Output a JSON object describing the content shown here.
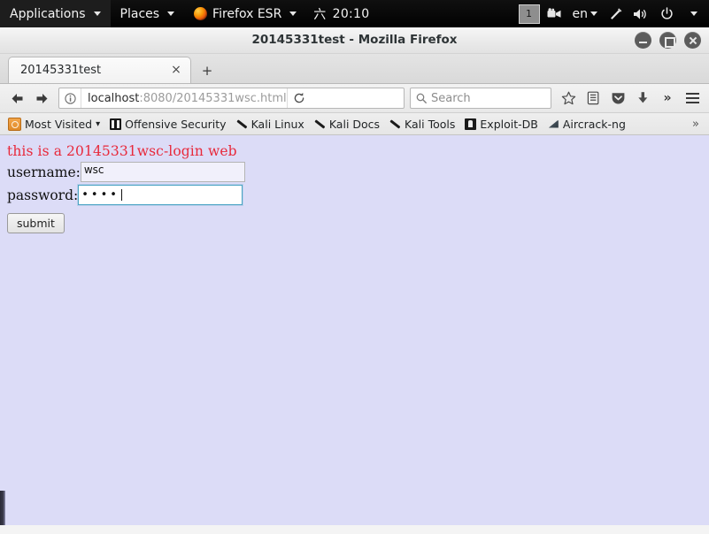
{
  "desktop_panel": {
    "menus": [
      {
        "label": "Applications",
        "icon": "chevron-down-icon"
      },
      {
        "label": "Places",
        "icon": "chevron-down-icon"
      },
      {
        "label": "Firefox ESR",
        "icon": "firefox-icon"
      }
    ],
    "clock": {
      "day": "六",
      "time": "20:10"
    },
    "workspace": "1",
    "tray": {
      "screencast_icon": "video-camera-icon",
      "language": "en",
      "language_caret": "chevron-down-icon",
      "network_icon": "signal-icon",
      "volume_icon": "speaker-icon",
      "power_icon": "power-icon",
      "power_caret": "chevron-down-icon"
    }
  },
  "window": {
    "title": "20145331test - Mozilla Firefox",
    "controls": {
      "minimize": "minimize-button",
      "maximize": "maximize-button",
      "close": "close-button"
    }
  },
  "tabs": {
    "items": [
      {
        "label": "20145331test",
        "close": "×"
      }
    ],
    "new_tab": "+"
  },
  "navbar": {
    "back": "←",
    "forward": "→",
    "identity_icon": "info-icon",
    "url_host": "localhost",
    "url_path": ":8080/20145331wsc.html",
    "reload": "⟳",
    "search_placeholder": "Search",
    "search_icon": "search-icon",
    "bookmark_icon": "star-icon",
    "library_icon": "library-icon",
    "pocket_icon": "pocket-icon",
    "downloads_icon": "download-icon",
    "overflow": "»",
    "menu_icon": "hamburger-menu-icon"
  },
  "bookmarks": {
    "items": [
      {
        "label": "Most Visited",
        "icon": "most-visited-icon",
        "caret": "▾"
      },
      {
        "label": "Offensive Security",
        "icon": "offensive-security-icon"
      },
      {
        "label": "Kali Linux",
        "icon": "kali-dragon-icon"
      },
      {
        "label": "Kali Docs",
        "icon": "kali-dragon-icon"
      },
      {
        "label": "Kali Tools",
        "icon": "kali-dragon-icon"
      },
      {
        "label": "Exploit-DB",
        "icon": "exploit-db-icon"
      },
      {
        "label": "Aircrack-ng",
        "icon": "aircrack-ng-icon"
      }
    ],
    "overflow": "»"
  },
  "page": {
    "heading": "this is a 20145331wsc-login web",
    "username_label": "username:",
    "username_value": "wsc",
    "password_label": "password:",
    "password_value": "••••",
    "submit_label": "submit",
    "background_color": "#dcdcf7",
    "heading_color": "#e8293b"
  }
}
